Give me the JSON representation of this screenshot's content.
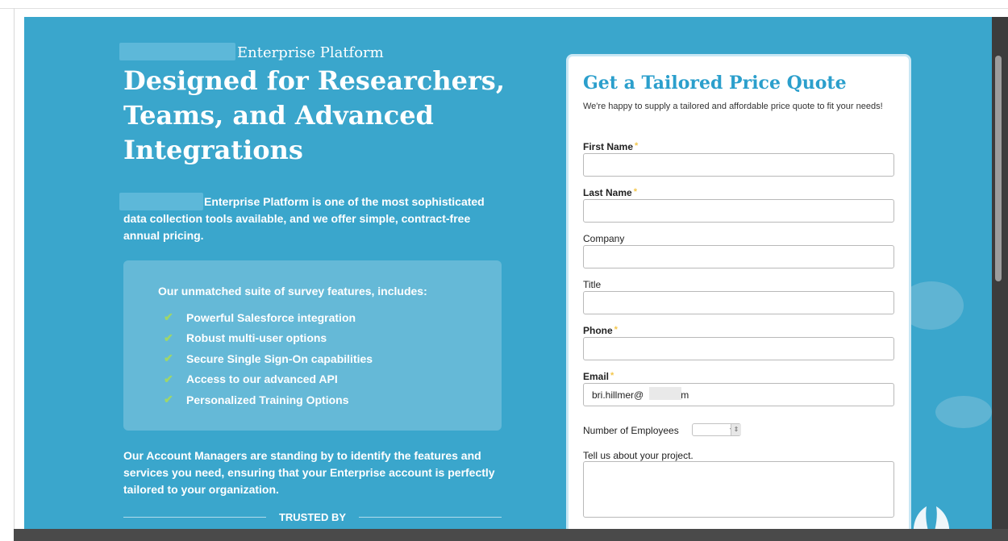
{
  "hero": {
    "kicker": "Enterprise Platform",
    "headline": "Designed for Researchers, Teams, and Advanced Integrations",
    "intro": "Enterprise Platform is one of the most sophisticated data collection tools available, and we offer simple, contract-free annual pricing."
  },
  "features": {
    "heading": "Our unmatched suite of survey features, includes:",
    "items": [
      "Powerful Salesforce integration",
      "Robust multi-user options",
      "Secure Single Sign-On capabilities",
      "Access to our advanced API",
      "Personalized Training Options"
    ]
  },
  "managers_text": "Our Account Managers are standing by to identify the features and services you need, ensuring that your Enterprise account is perfectly tailored to your organization.",
  "trusted_by": "TRUSTED BY",
  "form": {
    "title": "Get a Tailored Price Quote",
    "subtitle": "We're happy to supply a tailored and affordable price quote to fit your needs!",
    "first_name_label": "First Name",
    "last_name_label": "Last Name",
    "company_label": "Company",
    "title_label": "Title",
    "phone_label": "Phone",
    "email_label": "Email",
    "email_value": "bri.hillmer@          com",
    "employees_label": "Number of Employees",
    "project_label": "Tell us about your project.",
    "required_mark": "*"
  },
  "colors": {
    "hero_bg": "#3aa6cc",
    "form_title": "#2b9fcc",
    "check": "#9fd66a",
    "required_star": "#f3c64b"
  },
  "icons": {
    "check": "checkmark-icon",
    "select": "updown-chevron-icon"
  }
}
